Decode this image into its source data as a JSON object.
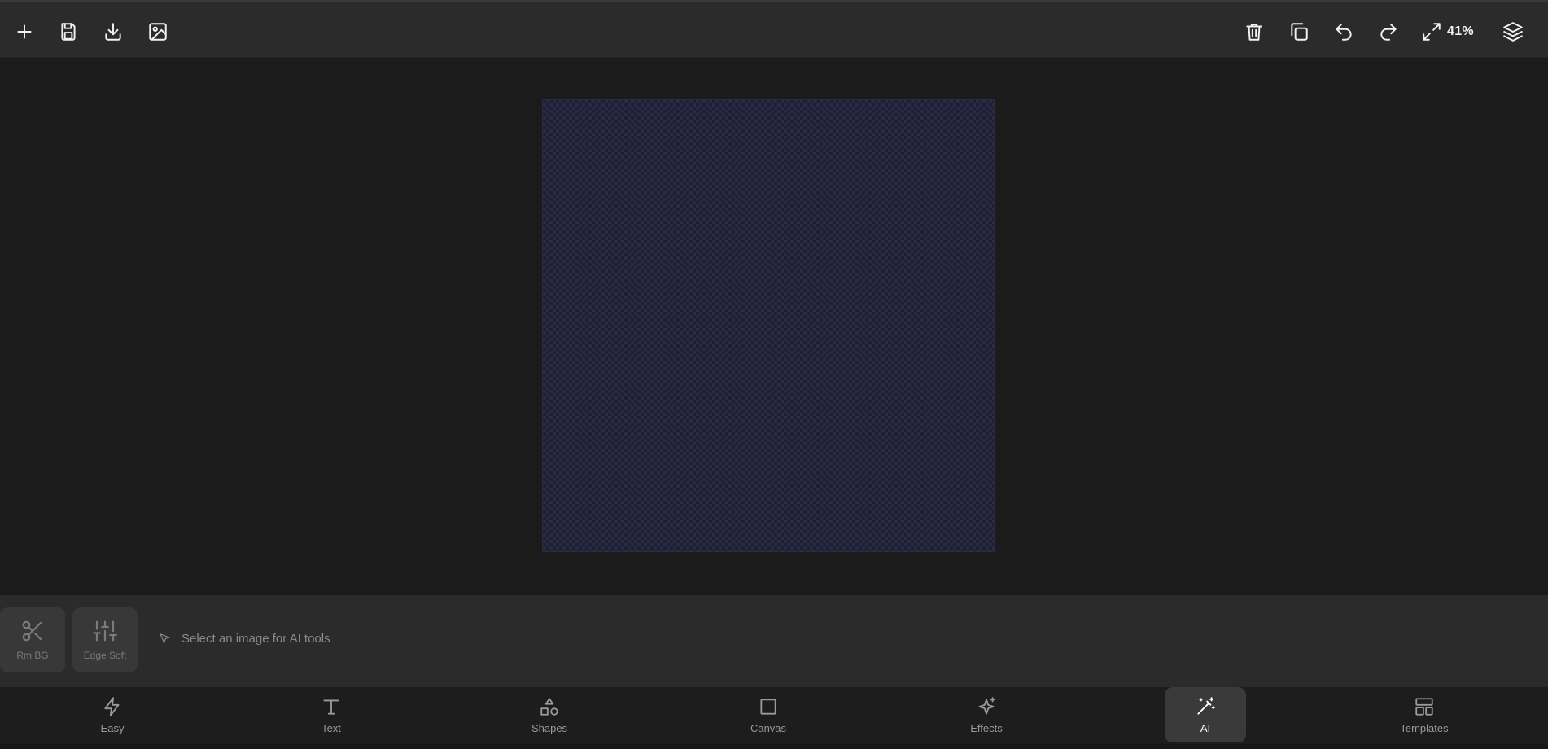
{
  "toolbar": {
    "left_icons": [
      "plus-icon",
      "save-icon",
      "download-icon",
      "image-icon"
    ],
    "right_icons": [
      "trash-icon",
      "duplicate-icon",
      "undo-icon",
      "redo-icon",
      "fit-screen-icon",
      "layers-icon"
    ],
    "zoom_level": "41%"
  },
  "canvas": {
    "background_color": "#1f1f33",
    "pattern": "checkerboard"
  },
  "ai_panel": {
    "tools": [
      {
        "label": "Rm BG",
        "icon": "scissors-icon"
      },
      {
        "label": "Edge Soft",
        "icon": "sliders-icon"
      }
    ],
    "hint": "Select an image for AI tools",
    "hint_icon": "cursor-icon"
  },
  "bottom_nav": {
    "items": [
      {
        "label": "Easy",
        "icon": "lightning-icon"
      },
      {
        "label": "Text",
        "icon": "text-icon"
      },
      {
        "label": "Shapes",
        "icon": "shapes-icon"
      },
      {
        "label": "Canvas",
        "icon": "square-icon"
      },
      {
        "label": "Effects",
        "icon": "sparkles-icon"
      },
      {
        "label": "AI",
        "icon": "magic-wand-icon"
      },
      {
        "label": "Templates",
        "icon": "layout-icon"
      }
    ],
    "active": "AI"
  }
}
